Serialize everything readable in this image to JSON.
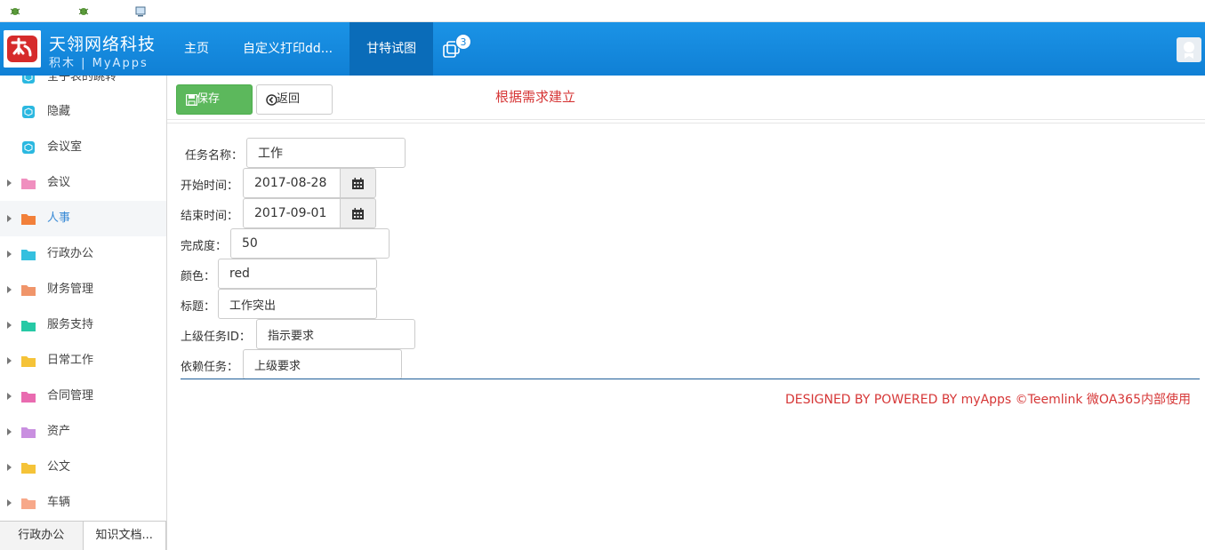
{
  "header": {
    "company": "天翎网络科技",
    "product": "积木 | MyApps",
    "nav": [
      {
        "label": "主页"
      },
      {
        "label": "自定义打印dd..."
      },
      {
        "label": "甘特试图"
      }
    ],
    "window_badge": "3"
  },
  "sidebar": {
    "items": [
      {
        "label": "全子表的跳转",
        "icon": "cube-icon",
        "color": "#2bb8e0"
      },
      {
        "label": "隐藏",
        "icon": "cube-icon",
        "color": "#2bb8e0"
      },
      {
        "label": "会议室",
        "icon": "cube-icon",
        "color": "#2bb8e0"
      },
      {
        "label": "会议",
        "icon": "folder-icon",
        "color": "#f08fbf"
      },
      {
        "label": "人事",
        "icon": "folder-icon",
        "color": "#f2803a"
      },
      {
        "label": "行政办公",
        "icon": "folder-icon",
        "color": "#35c0df"
      },
      {
        "label": "财务管理",
        "icon": "folder-icon",
        "color": "#f0956a"
      },
      {
        "label": "服务支持",
        "icon": "folder-icon",
        "color": "#26c9a5"
      },
      {
        "label": "日常工作",
        "icon": "folder-icon",
        "color": "#f5c338"
      },
      {
        "label": "合同管理",
        "icon": "folder-icon",
        "color": "#e96bb0"
      },
      {
        "label": "资产",
        "icon": "folder-icon",
        "color": "#c98fe0"
      },
      {
        "label": "公文",
        "icon": "folder-icon",
        "color": "#f5c338"
      },
      {
        "label": "车辆",
        "icon": "folder-icon",
        "color": "#f7a889"
      }
    ],
    "tabs": [
      {
        "label": "行政办公"
      },
      {
        "label": "知识文档..."
      }
    ]
  },
  "toolbar": {
    "save_label": "保存",
    "back_label": "返回",
    "hint": "根据需求建立"
  },
  "form": {
    "task_name": {
      "label": "任务名称：",
      "value": "工作"
    },
    "start_time": {
      "label": "开始时间：",
      "value": "2017-08-28"
    },
    "end_time": {
      "label": "结束时间：",
      "value": "2017-09-01"
    },
    "progress": {
      "label": "完成度：",
      "value": "50"
    },
    "color": {
      "label": "颜色：",
      "value": "red"
    },
    "title": {
      "label": "标题：",
      "value": "工作突出"
    },
    "parent_id": {
      "label": "上级任务ID：",
      "value": "指示要求"
    },
    "depends": {
      "label": "依赖任务：",
      "value": "上级要求"
    }
  },
  "footer": {
    "text": "DESIGNED BY POWERED BY myApps ©Teemlink 微OA365内部使用"
  },
  "colors": {
    "header": "#1287da",
    "save_button": "#5cb85c",
    "accent_red": "#d63636"
  }
}
